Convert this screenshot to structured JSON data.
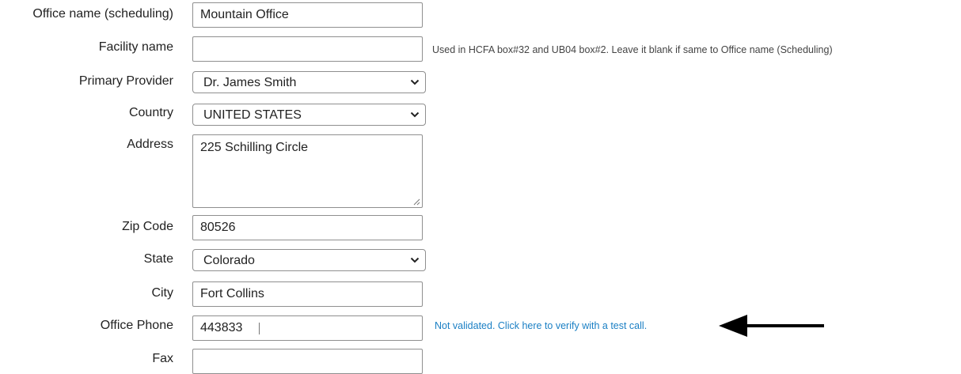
{
  "office_name": {
    "label": "Office name (scheduling)",
    "value": "Mountain Office"
  },
  "facility_name": {
    "label": "Facility name",
    "value": "",
    "hint": "Used in HCFA box#32 and UB04 box#2. Leave it blank if same to Office name (Scheduling)"
  },
  "primary_provider": {
    "label": "Primary Provider",
    "selected": "Dr. James Smith"
  },
  "country": {
    "label": "Country",
    "selected": "UNITED STATES"
  },
  "address": {
    "label": "Address",
    "value": "225 Schilling Circle"
  },
  "zip_code": {
    "label": "Zip Code",
    "value": "80526"
  },
  "state": {
    "label": "State",
    "selected": "Colorado"
  },
  "city": {
    "label": "City",
    "value": "Fort Collins"
  },
  "office_phone": {
    "label": "Office Phone",
    "value": "443833",
    "verify_link": "Not validated. Click here to verify with a test call."
  },
  "fax": {
    "label": "Fax",
    "value": ""
  },
  "colors": {
    "link": "#1a7fc4",
    "border": "#8f8f8f",
    "text": "#222222"
  }
}
